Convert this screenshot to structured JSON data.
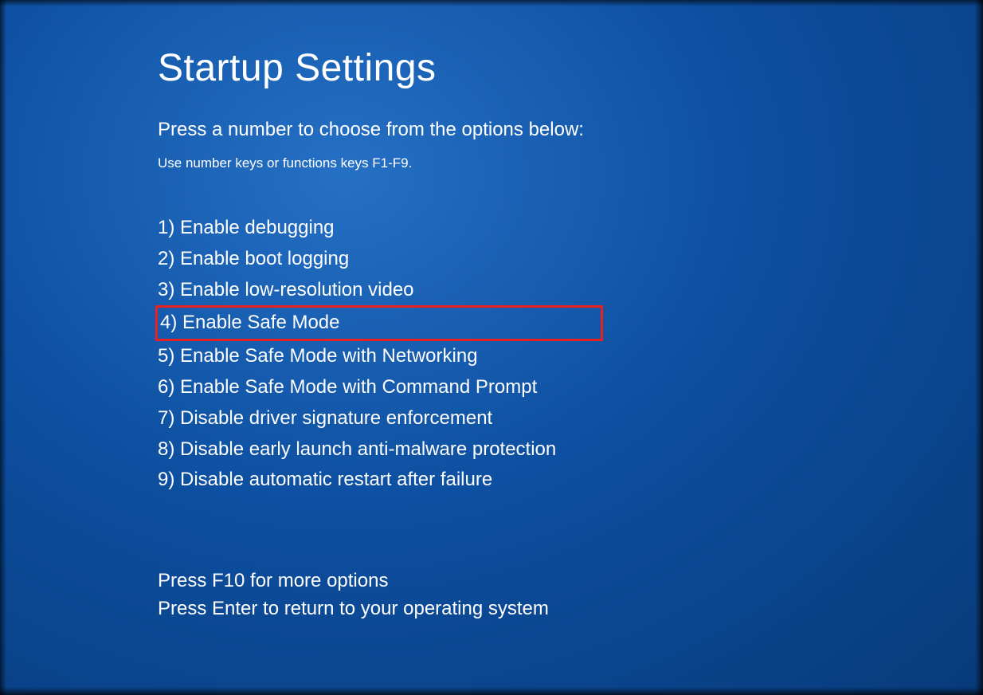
{
  "title": "Startup Settings",
  "subtitle": "Press a number to choose from the options below:",
  "hint": "Use number keys or functions keys F1-F9.",
  "options": [
    {
      "number": "1)",
      "label": "Enable debugging",
      "highlighted": false
    },
    {
      "number": "2)",
      "label": "Enable boot logging",
      "highlighted": false
    },
    {
      "number": "3)",
      "label": "Enable low-resolution video",
      "highlighted": false
    },
    {
      "number": "4)",
      "label": "Enable Safe Mode",
      "highlighted": true
    },
    {
      "number": "5)",
      "label": "Enable Safe Mode with Networking",
      "highlighted": false
    },
    {
      "number": "6)",
      "label": "Enable Safe Mode with Command Prompt",
      "highlighted": false
    },
    {
      "number": "7)",
      "label": "Disable driver signature enforcement",
      "highlighted": false
    },
    {
      "number": "8)",
      "label": "Disable early launch anti-malware protection",
      "highlighted": false
    },
    {
      "number": "9)",
      "label": "Disable automatic restart after failure",
      "highlighted": false
    }
  ],
  "footer": {
    "line1": "Press F10 for more options",
    "line2": "Press Enter to return to your operating system"
  },
  "highlight_color": "#e82020"
}
